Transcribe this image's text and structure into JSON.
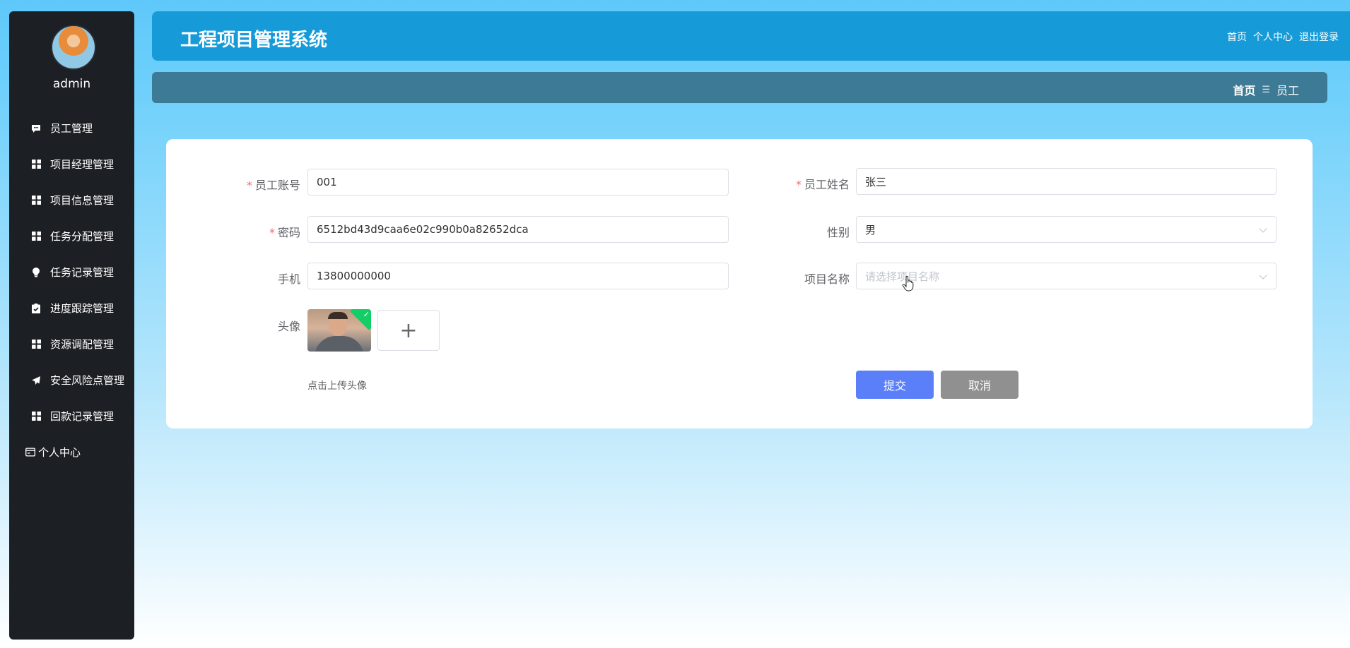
{
  "sidebar": {
    "username": "admin",
    "items": [
      {
        "label": "员工管理",
        "icon": "chat-icon"
      },
      {
        "label": "项目经理管理",
        "icon": "grid-icon"
      },
      {
        "label": "项目信息管理",
        "icon": "grid-icon"
      },
      {
        "label": "任务分配管理",
        "icon": "grid-icon"
      },
      {
        "label": "任务记录管理",
        "icon": "bulb-icon"
      },
      {
        "label": "进度跟踪管理",
        "icon": "clipboard-icon"
      },
      {
        "label": "资源调配管理",
        "icon": "grid-icon"
      },
      {
        "label": "安全风险点管理",
        "icon": "send-icon"
      },
      {
        "label": "回款记录管理",
        "icon": "grid-icon"
      }
    ],
    "personal": "个人中心"
  },
  "header": {
    "title": "工程项目管理系统",
    "links": {
      "home": "首页",
      "personal": "个人中心",
      "logout": "退出登录"
    }
  },
  "breadcrumb": {
    "home": "首页",
    "separator": "☰",
    "current": "员工"
  },
  "form": {
    "account": {
      "label": "员工账号",
      "value": "001"
    },
    "name": {
      "label": "员工姓名",
      "value": "张三"
    },
    "password": {
      "label": "密码",
      "value": "6512bd43d9caa6e02c990b0a82652dca"
    },
    "gender": {
      "label": "性别",
      "value": "男"
    },
    "phone": {
      "label": "手机",
      "value": "13800000000"
    },
    "project": {
      "label": "项目名称",
      "placeholder": "请选择项目名称"
    },
    "avatar": {
      "label": "头像",
      "tip": "点击上传头像"
    },
    "submit": "提交",
    "cancel": "取消"
  },
  "colors": {
    "header": "#179bd8",
    "crumb": "#3d7a95",
    "sidebar": "#1c1f24",
    "submit": "#5b7ff8",
    "cancel": "#909090",
    "required": "#f56c6c"
  }
}
